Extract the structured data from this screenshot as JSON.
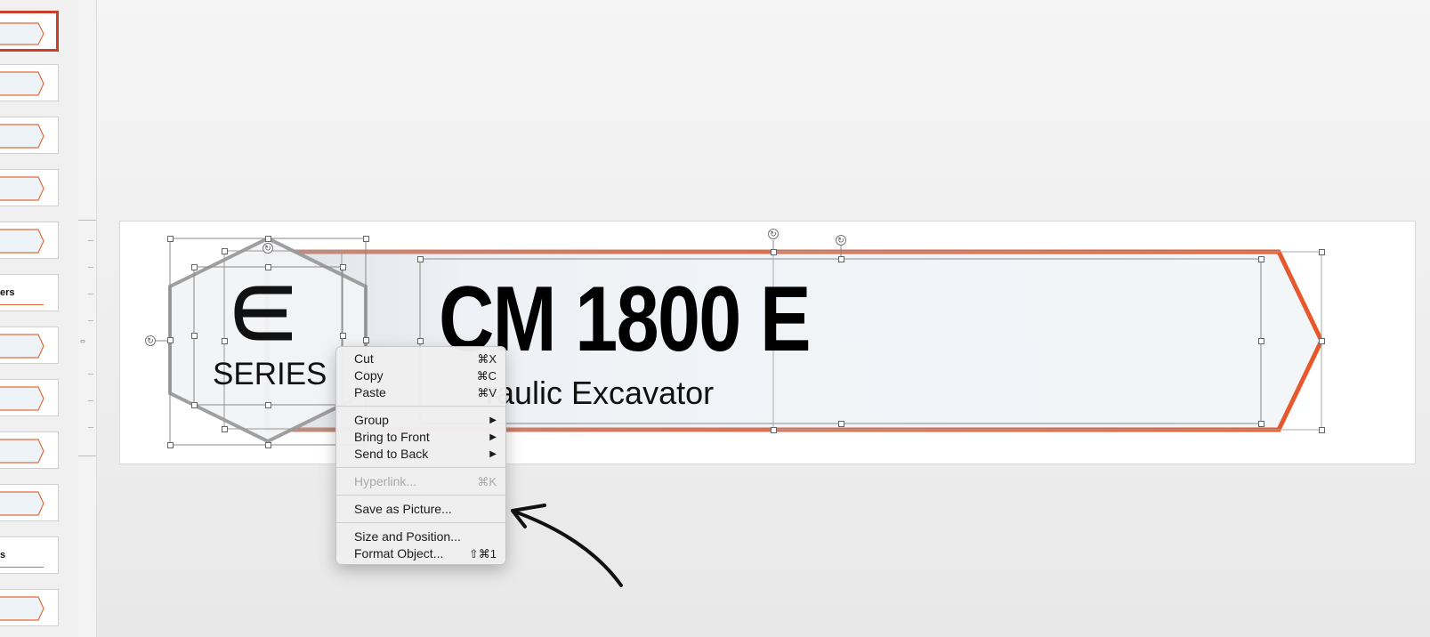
{
  "thumbnails": {
    "labels": [
      "ers",
      "s"
    ]
  },
  "ruler": {
    "zero_label": "0"
  },
  "slide": {
    "product_title": "CM 1800 E",
    "product_subtitle": "raulic Excavator",
    "logo_mark": "Є",
    "series_label": "SERIES",
    "colors": {
      "accent": "#e8572a",
      "banner_fill": "#f1f4f7",
      "hexagon": "#a8a8a8"
    }
  },
  "context_menu": {
    "items": [
      {
        "label": "Cut",
        "shortcut": "⌘X"
      },
      {
        "label": "Copy",
        "shortcut": "⌘C"
      },
      {
        "label": "Paste",
        "shortcut": "⌘V"
      },
      {
        "label": "Group",
        "submenu": "▶"
      },
      {
        "label": "Bring to Front",
        "submenu": "▶"
      },
      {
        "label": "Send to Back",
        "submenu": "▶"
      },
      {
        "label": "Hyperlink...",
        "shortcut": "⌘K",
        "disabled": true
      },
      {
        "label": "Save as Picture..."
      },
      {
        "label": "Size and Position..."
      },
      {
        "label": "Format Object...",
        "shortcut": "⇧⌘1"
      }
    ]
  }
}
